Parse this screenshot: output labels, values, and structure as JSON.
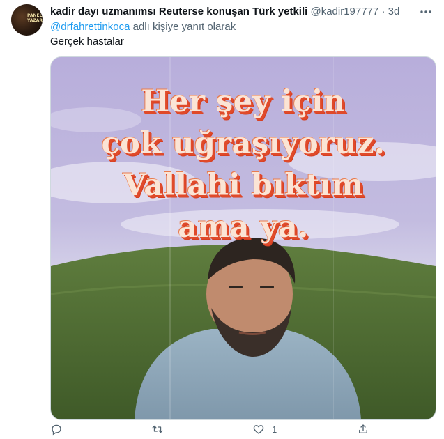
{
  "tweet": {
    "author_name": "kadir dayı uzmanımsı Reuterse konuşan Türk yetkili",
    "author_handle": "@kadir197777",
    "separator": "·",
    "timestamp": "3d",
    "avatar_text": "PANEL YAZAR",
    "reply_to_handle": "@drfahrettinkoca",
    "reply_suffix": "adlı kişiye yanıt olarak",
    "text": "Gerçek hastalar",
    "meme": {
      "line1": "Her şey için",
      "line2": "çok uğraşıyoruz.",
      "line3": "Vallahi bıktım",
      "line4": "ama ya."
    },
    "actions": {
      "reply_count": "",
      "retweet_count": "",
      "like_count": "1",
      "share_count": ""
    }
  },
  "colors": {
    "link": "#1d9bf0",
    "muted": "#536471",
    "meme_text": "#fbe4d5",
    "meme_shadow": "#e04a2a"
  },
  "icons": [
    "more-icon",
    "reply-icon",
    "retweet-icon",
    "like-icon",
    "share-icon"
  ]
}
